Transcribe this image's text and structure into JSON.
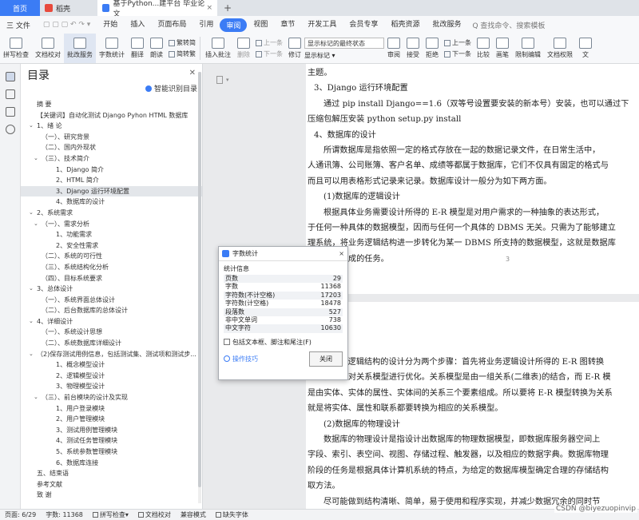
{
  "tabs": {
    "home": "首页",
    "wps": "稻壳",
    "doc": "基于Python...建平台 毕业论文",
    "add": "+"
  },
  "menu": {
    "file": "三 文件",
    "items": [
      "开始",
      "插入",
      "页面布局",
      "引用",
      "审阅",
      "视图",
      "章节",
      "开发工具",
      "会员专享",
      "稻壳资源",
      "批改服务"
    ],
    "active_index": 4,
    "search": "Q 查找命令、搜索模板"
  },
  "ribbon": {
    "spell": "拼写检查",
    "proofread": "文档校对",
    "grading": "批改服务",
    "wordcount": "字数统计",
    "translate": "翻译",
    "read": "朗读",
    "simp_trad": "繁转简",
    "trad_simp": "简转繁",
    "insert_comment": "插入批注",
    "delete": "删除",
    "prev": "上一条",
    "next": "下一条",
    "revise": "修订",
    "markup_select": "显示标记的最终状态",
    "show_markup": "显示标记",
    "review": "审阅",
    "accept": "接受",
    "reject": "拒绝",
    "prev2": "上一条",
    "next2": "下一条",
    "compare": "比较",
    "ink": "画笔",
    "restrict": "限制编辑",
    "doc_perm": "文档权限",
    "more": "文"
  },
  "toc": {
    "title": "目录",
    "smart": "智能识别目录",
    "items": [
      {
        "text": "摘  要",
        "indent": 1,
        "chev": ""
      },
      {
        "text": "【关键词】自动化测试 Django Pyhon HTML 数据库",
        "indent": 1,
        "chev": ""
      },
      {
        "text": "1、绪  论",
        "indent": 1,
        "chev": "v"
      },
      {
        "text": "（一）、研究背景",
        "indent": 2,
        "chev": ""
      },
      {
        "text": "（二）、国内外现状",
        "indent": 2,
        "chev": ""
      },
      {
        "text": "（三）、技术简介",
        "indent": 2,
        "chev": "v"
      },
      {
        "text": "1、Django 简介",
        "indent": 3,
        "chev": ""
      },
      {
        "text": "2、HTML 简介",
        "indent": 3,
        "chev": ""
      },
      {
        "text": "3、Django 运行环境配置",
        "indent": 3,
        "chev": "",
        "selected": true
      },
      {
        "text": "4、数据库的设计",
        "indent": 3,
        "chev": ""
      },
      {
        "text": "2、系统需求",
        "indent": 1,
        "chev": "v"
      },
      {
        "text": "（一）、需求分析",
        "indent": 2,
        "chev": "v"
      },
      {
        "text": "1、功能需求",
        "indent": 3,
        "chev": ""
      },
      {
        "text": "2、安全性需求",
        "indent": 3,
        "chev": ""
      },
      {
        "text": "（二）、系统的可行性",
        "indent": 2,
        "chev": ""
      },
      {
        "text": "（三）、系统结构化分析",
        "indent": 2,
        "chev": ""
      },
      {
        "text": "（四）、目标系统要求",
        "indent": 2,
        "chev": ""
      },
      {
        "text": "3、总体设计",
        "indent": 1,
        "chev": "v"
      },
      {
        "text": "（一）、系统界面总体设计",
        "indent": 2,
        "chev": ""
      },
      {
        "text": "（二）、后台数据库的总体设计",
        "indent": 2,
        "chev": ""
      },
      {
        "text": "4、详细设计",
        "indent": 1,
        "chev": "v"
      },
      {
        "text": "（一）、系统设计思想",
        "indent": 2,
        "chev": ""
      },
      {
        "text": "（二）、系统数据库详细设计",
        "indent": 2,
        "chev": ""
      },
      {
        "text": "（2)保存测试用例信息，包括测试集、测试项和测试步...",
        "indent": 1,
        "chev": "v"
      },
      {
        "text": "1、概念模型设计",
        "indent": 3,
        "chev": ""
      },
      {
        "text": "2、逻辑模型设计",
        "indent": 3,
        "chev": ""
      },
      {
        "text": "3、物理模型设计",
        "indent": 3,
        "chev": ""
      },
      {
        "text": "（三）、前台模块的设计及实现",
        "indent": 2,
        "chev": "v"
      },
      {
        "text": "1、用户登录模块",
        "indent": 3,
        "chev": ""
      },
      {
        "text": "2、用户管理模块",
        "indent": 3,
        "chev": ""
      },
      {
        "text": "3、测试用例管理模块",
        "indent": 3,
        "chev": ""
      },
      {
        "text": "4、测试任务管理模块",
        "indent": 3,
        "chev": ""
      },
      {
        "text": "5、系统参数管理模块",
        "indent": 3,
        "chev": ""
      },
      {
        "text": "6、数据库连接",
        "indent": 3,
        "chev": ""
      },
      {
        "text": "五、结束语",
        "indent": 1,
        "chev": ""
      },
      {
        "text": "参考文献",
        "indent": 1,
        "chev": ""
      },
      {
        "text": "致  谢",
        "indent": 1,
        "chev": ""
      }
    ]
  },
  "page1": {
    "lines": [
      {
        "t": "主题。",
        "x": 0
      },
      {
        "t": "3、Django 运行环境配置",
        "x": 8
      },
      {
        "t": "通过 pip install Django==1.6（双等号设置要安装的新本号）安装，也可以通过下",
        "x": 20
      },
      {
        "t": "压缩包解压安装 python setup.py install",
        "x": 0
      },
      {
        "t": "4、数据库的设计",
        "x": 8
      },
      {
        "t": "所谓数据库是指依照一定的格式存放在一起的数据记录文件，在日常生活中，",
        "x": 20
      },
      {
        "t": "人通讯簿、公司账簿、客户名单、成绩等都属于数据库，它们不仅具有固定的格式与",
        "x": 0
      },
      {
        "t": "而且可以用表格形式记录来记录。数据库设计一般分为如下两方面。",
        "x": 0
      },
      {
        "t": "(1)数据库的逻辑设计",
        "x": 20
      },
      {
        "t": "根据具体业务需要设计所得的 E-R 模型是对用户需求的一种抽象的表达形式，",
        "x": 20
      },
      {
        "t": "于任何一种具体的数据模型，因而与任何一个具体的 DBMS 无关。只需为了能够建立",
        "x": 0
      },
      {
        "t": "理系统，将业务逻辑结构进一步转化为某一 DBMS 所支持的数据模型，这就是数据库",
        "x": 0
      },
      {
        "t": "设计所要完成的任务。",
        "x": 0
      }
    ],
    "page_number": "3"
  },
  "page2": {
    "lines": [
      {
        "t": "数据库逻辑结构的设计分为两个步骤：首先将业务逻辑设计所得的 E-R 图转换",
        "x": 20
      },
      {
        "t": "模型，然后对关系模型进行优化。关系模型是由一组关系(二维表)的结合，而 E-R 模",
        "x": 0
      },
      {
        "t": "是由实体、实体的属性、实体间的关系三个要素组成。所以要将 E-R 模型转换为关系",
        "x": 0
      },
      {
        "t": "就是将实体、属性和联系都要转换为相应的关系模型。",
        "x": 0
      },
      {
        "t": "(2)数据库的物理设计",
        "x": 20
      },
      {
        "t": "数据库的物理设计是指设计出数据库的物理数据模型，即数据库服务器空间上",
        "x": 20
      },
      {
        "t": "字段、索引、表空间、视图、存储过程、触发器，以及相应的数据字典。数据库物理",
        "x": 0
      },
      {
        "t": "阶段的任务是根据具体计算机系统的特点，为给定的数据库模型确定合理的存储结构",
        "x": 0
      },
      {
        "t": "取方法。",
        "x": 0
      },
      {
        "t": "尽可能做到结构清晰、简单，易于使用和程序实现，并减少数据冗余的同时节",
        "x": 20
      },
      {
        "t": "储空间，同时以提高一致、一次的速度",
        "x": 0
      }
    ]
  },
  "dialog": {
    "title": "字数统计",
    "section": "统计信息",
    "stats": [
      {
        "label": "页数",
        "value": "29"
      },
      {
        "label": "字数",
        "value": "11368"
      },
      {
        "label": "字符数(不计空格)",
        "value": "17203"
      },
      {
        "label": "字符数(计空格)",
        "value": "18478"
      },
      {
        "label": "段落数",
        "value": "527"
      },
      {
        "label": "非中文单词",
        "value": "738"
      },
      {
        "label": "中文字符",
        "value": "10630"
      }
    ],
    "checkbox": "包括文本框、脚注和尾注(F)",
    "tips": "操作技巧",
    "close_btn": "关闭",
    "close_x": "×"
  },
  "status": {
    "page": "页面: 6/29",
    "words": "字数: 11368",
    "spell": "拼写检查",
    "proof": "文档校对",
    "compat": "兼容模式",
    "font_missing": "缺失字体"
  },
  "watermark": "CSDN @biyezuopinvip",
  "colors": {
    "accent": "#3b7cf5",
    "tab_bg": "#dfe3e8"
  }
}
